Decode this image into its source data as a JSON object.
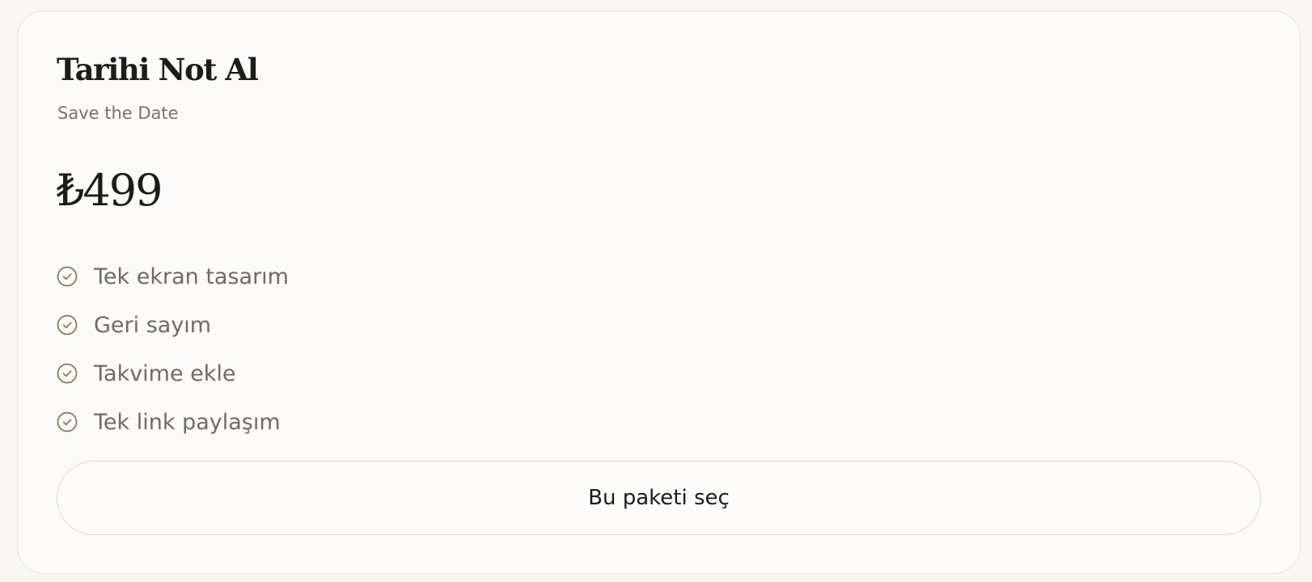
{
  "plan": {
    "title": "Tarihi Not Al",
    "subtitle": "Save the Date",
    "price": "₺499",
    "features": [
      "Tek ekran tasarım",
      "Geri sayım",
      "Takvime ekle",
      "Tek link paylaşım"
    ],
    "feature_icon": "check-circle-icon",
    "cta_label": "Bu paketi seç"
  },
  "colors": {
    "background": "#f8f7f4",
    "card_background": "#fcfbf9",
    "accent_check": "#8a7352",
    "text_primary": "#1e1c19",
    "text_secondary": "#6f6a63"
  }
}
